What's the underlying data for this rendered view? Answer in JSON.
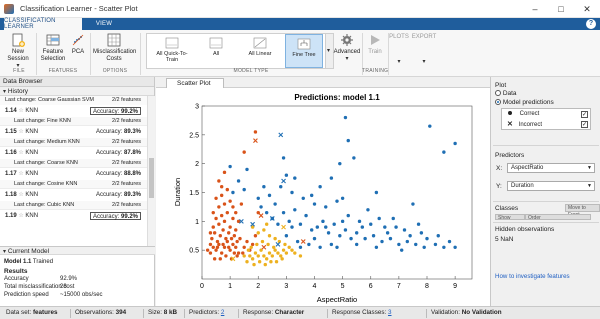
{
  "window": {
    "title": "Classification Learner - Scatter Plot"
  },
  "tabs": {
    "classification_learner": "CLASSIFICATION LEARNER",
    "view": "VIEW",
    "help": "?"
  },
  "toolstrip": {
    "new_session": "New Session",
    "feature_selection": "Feature Selection",
    "pca": "PCA",
    "misclassification_costs": "Misclassification Costs",
    "gallery": [
      {
        "label": "All Quick-To-Train"
      },
      {
        "label": "All"
      },
      {
        "label": "All Linear"
      },
      {
        "label": "Fine Tree"
      }
    ],
    "advanced": "Advanced",
    "train": "Train",
    "plots": "PLOTS",
    "export": "EXPORT",
    "sections": {
      "file": "FILE",
      "features": "FEATURES",
      "options": "OPTIONS",
      "model_type": "MODEL TYPE",
      "training": "TRAINING"
    }
  },
  "left": {
    "data_browser": "Data Browser",
    "history_title": "History",
    "top_last_change": "Coarse Gaussian SVM",
    "top_features": "2/2 features",
    "models": [
      {
        "id": "1.14",
        "name": "KNN",
        "accuracy": "99.2%",
        "acc_label": "Accuracy:",
        "last_change": "Fine KNN",
        "features": "2/2 features",
        "boxed": true
      },
      {
        "id": "1.15",
        "name": "KNN",
        "accuracy": "89.3%",
        "acc_label": "Accuracy:",
        "last_change": "Medium KNN",
        "features": "2/2 features",
        "boxed": false
      },
      {
        "id": "1.16",
        "name": "KNN",
        "accuracy": "87.8%",
        "acc_label": "Accuracy:",
        "last_change": "Coarse KNN",
        "features": "2/2 features",
        "boxed": false
      },
      {
        "id": "1.17",
        "name": "KNN",
        "accuracy": "88.8%",
        "acc_label": "Accuracy:",
        "last_change": "Cosine KNN",
        "features": "2/2 features",
        "boxed": false
      },
      {
        "id": "1.18",
        "name": "KNN",
        "accuracy": "89.3%",
        "acc_label": "Accuracy:",
        "last_change": "Cubic KNN",
        "features": "2/2 features",
        "boxed": false
      },
      {
        "id": "1.19",
        "name": "KNN",
        "accuracy": "99.2%",
        "acc_label": "Accuracy:",
        "last_change": "",
        "features": "",
        "boxed": true
      }
    ],
    "last_change_label": "Last change:",
    "current_model_title": "Current Model",
    "current_model": {
      "name": "Model 1.1",
      "status": "Trained"
    },
    "results_title": "Results",
    "results": [
      {
        "label": "Accuracy",
        "value": "92.9%"
      },
      {
        "label": "Total misclassification cost",
        "value": "28"
      },
      {
        "label": "Prediction speed",
        "value": "~15000 obs/sec"
      }
    ]
  },
  "center": {
    "tab_label": "Scatter Plot",
    "plot_title": "Predictions: model 1.1"
  },
  "chart_data": {
    "type": "scatter",
    "title": "Predictions: model 1.1",
    "xlabel": "AspectRatio",
    "ylabel": "Duration",
    "xlim": [
      0,
      9.6
    ],
    "ylim": [
      0,
      3.0
    ],
    "xticks": [
      0,
      1,
      2,
      3,
      4,
      5,
      6,
      7,
      8,
      9
    ],
    "yticks": [
      0.5,
      1,
      1.5,
      2,
      2.5,
      3
    ],
    "grid": false,
    "series": [
      {
        "name": "",
        "color": "#1f6fb4",
        "marker": "dot",
        "points": [
          [
            2.9,
            1.15
          ],
          [
            3.1,
            1.0
          ],
          [
            3.3,
            1.2
          ],
          [
            3.5,
            0.95
          ],
          [
            3.7,
            1.1
          ],
          [
            3.9,
            0.85
          ],
          [
            4.1,
            0.9
          ],
          [
            4.3,
            1.0
          ],
          [
            4.5,
            0.8
          ],
          [
            4.7,
            0.95
          ],
          [
            4.9,
            0.75
          ],
          [
            5.1,
            0.85
          ],
          [
            5.3,
            0.7
          ],
          [
            5.5,
            0.8
          ],
          [
            5.8,
            0.7
          ],
          [
            6.1,
            0.75
          ],
          [
            6.4,
            0.65
          ],
          [
            6.7,
            0.7
          ],
          [
            7.0,
            0.6
          ],
          [
            7.3,
            0.65
          ],
          [
            7.6,
            0.6
          ],
          [
            7.9,
            0.55
          ],
          [
            8.3,
            0.6
          ],
          [
            8.6,
            0.55
          ],
          [
            9.0,
            0.55
          ],
          [
            3.2,
            1.5
          ],
          [
            3.6,
            1.4
          ],
          [
            4.0,
            1.3
          ],
          [
            4.4,
            1.25
          ],
          [
            4.8,
            1.35
          ],
          [
            5.2,
            1.1
          ],
          [
            5.6,
            1.0
          ],
          [
            6.0,
            0.95
          ],
          [
            6.5,
            0.9
          ],
          [
            7.2,
            0.85
          ],
          [
            7.8,
            0.8
          ],
          [
            8.4,
            0.75
          ],
          [
            2.6,
            1.3
          ],
          [
            2.8,
            1.6
          ],
          [
            3.0,
            1.8
          ],
          [
            2.9,
            2.1
          ],
          [
            3.3,
            1.75
          ],
          [
            4.2,
            1.6
          ],
          [
            5.0,
            1.4
          ],
          [
            5.9,
            1.2
          ],
          [
            6.8,
            1.05
          ],
          [
            4.6,
            1.75
          ],
          [
            6.2,
            1.5
          ],
          [
            7.5,
            1.3
          ],
          [
            5.4,
            2.1
          ],
          [
            5.2,
            2.4
          ],
          [
            4.9,
            2.0
          ],
          [
            5.1,
            2.8
          ],
          [
            8.1,
            2.65
          ],
          [
            8.6,
            2.2
          ],
          [
            9.0,
            2.35
          ],
          [
            1.0,
            1.95
          ],
          [
            1.3,
            1.7
          ],
          [
            1.1,
            1.5
          ],
          [
            1.6,
            1.9
          ],
          [
            1.5,
            1.55
          ],
          [
            2.0,
            1.4
          ],
          [
            2.2,
            1.6
          ],
          [
            2.3,
            1.15
          ],
          [
            2.5,
            1.05
          ],
          [
            2.7,
            0.95
          ],
          [
            3.4,
            0.65
          ],
          [
            3.8,
            0.6
          ],
          [
            4.2,
            0.55
          ],
          [
            4.8,
            0.55
          ],
          [
            5.5,
            0.6
          ],
          [
            6.2,
            0.55
          ],
          [
            7.1,
            0.5
          ],
          [
            6.9,
            0.9
          ],
          [
            7.7,
            0.95
          ],
          [
            3.0,
            0.75
          ],
          [
            3.5,
            0.55
          ],
          [
            4.0,
            0.7
          ],
          [
            4.6,
            0.6
          ],
          [
            5.0,
            1.0
          ],
          [
            5.7,
            0.9
          ],
          [
            6.3,
            1.05
          ],
          [
            3.9,
            1.45
          ],
          [
            4.4,
            0.9
          ],
          [
            2.1,
            1.25
          ],
          [
            2.4,
            1.45
          ],
          [
            3.2,
            0.9
          ],
          [
            6.6,
            0.8
          ],
          [
            7.4,
            0.75
          ],
          [
            8.0,
            0.7
          ],
          [
            8.8,
            0.65
          ]
        ]
      },
      {
        "name": "",
        "color": "#d95319",
        "marker": "dot",
        "points": [
          [
            0.3,
            0.45
          ],
          [
            0.4,
            0.55
          ],
          [
            0.5,
            0.5
          ],
          [
            0.6,
            0.6
          ],
          [
            0.7,
            0.45
          ],
          [
            0.8,
            0.55
          ],
          [
            0.9,
            0.65
          ],
          [
            1.0,
            0.5
          ],
          [
            1.1,
            0.6
          ],
          [
            1.2,
            0.55
          ],
          [
            1.3,
            0.45
          ],
          [
            0.35,
            0.7
          ],
          [
            0.45,
            0.8
          ],
          [
            0.55,
            0.65
          ],
          [
            0.65,
            0.75
          ],
          [
            0.75,
            0.85
          ],
          [
            0.85,
            0.7
          ],
          [
            0.95,
            0.8
          ],
          [
            1.05,
            0.7
          ],
          [
            1.15,
            0.75
          ],
          [
            1.25,
            0.65
          ],
          [
            1.35,
            0.7
          ],
          [
            0.4,
            0.9
          ],
          [
            0.6,
            0.95
          ],
          [
            0.8,
            1.0
          ],
          [
            1.0,
            0.9
          ],
          [
            1.2,
            0.85
          ],
          [
            0.5,
            1.05
          ],
          [
            0.7,
            1.1
          ],
          [
            0.9,
            1.15
          ],
          [
            1.1,
            1.05
          ],
          [
            0.6,
            1.25
          ],
          [
            0.8,
            1.3
          ],
          [
            0.7,
            1.45
          ],
          [
            0.9,
            1.55
          ],
          [
            0.5,
            1.4
          ],
          [
            0.6,
            1.7
          ],
          [
            0.8,
            1.85
          ],
          [
            0.7,
            1.6
          ],
          [
            1.0,
            1.35
          ],
          [
            1.3,
            1.0
          ],
          [
            1.5,
            0.55
          ],
          [
            1.6,
            0.65
          ],
          [
            1.7,
            0.5
          ],
          [
            0.3,
            0.6
          ],
          [
            0.2,
            0.5
          ],
          [
            0.3,
            0.8
          ],
          [
            0.45,
            0.35
          ],
          [
            0.65,
            0.35
          ],
          [
            0.85,
            0.4
          ],
          [
            1.05,
            0.35
          ],
          [
            1.25,
            0.4
          ],
          [
            1.45,
            0.45
          ],
          [
            0.55,
            0.55
          ],
          [
            0.75,
            0.6
          ],
          [
            0.95,
            0.55
          ],
          [
            1.15,
            0.45
          ],
          [
            0.4,
            1.15
          ],
          [
            1.1,
            1.25
          ],
          [
            1.2,
            1.15
          ],
          [
            1.8,
            0.6
          ],
          [
            1.9,
            0.75
          ],
          [
            2.0,
            1.15
          ],
          [
            1.9,
            2.55
          ],
          [
            1.5,
            2.2
          ],
          [
            1.4,
            1.3
          ]
        ]
      },
      {
        "name": "",
        "color": "#edb120",
        "marker": "dot",
        "points": [
          [
            1.7,
            0.4
          ],
          [
            1.8,
            0.35
          ],
          [
            1.9,
            0.45
          ],
          [
            2.0,
            0.4
          ],
          [
            2.1,
            0.5
          ],
          [
            2.2,
            0.4
          ],
          [
            2.3,
            0.35
          ],
          [
            2.4,
            0.45
          ],
          [
            2.5,
            0.4
          ],
          [
            2.6,
            0.5
          ],
          [
            2.7,
            0.45
          ],
          [
            2.8,
            0.4
          ],
          [
            2.9,
            0.5
          ],
          [
            3.0,
            0.45
          ],
          [
            3.1,
            0.55
          ],
          [
            3.2,
            0.5
          ],
          [
            1.6,
            0.3
          ],
          [
            1.75,
            0.55
          ],
          [
            1.95,
            0.6
          ],
          [
            2.15,
            0.65
          ],
          [
            2.35,
            0.6
          ],
          [
            2.55,
            0.55
          ],
          [
            2.75,
            0.65
          ],
          [
            2.95,
            0.6
          ],
          [
            3.3,
            0.45
          ],
          [
            3.5,
            0.4
          ],
          [
            1.5,
            0.4
          ],
          [
            1.65,
            0.5
          ],
          [
            1.85,
            0.25
          ],
          [
            2.05,
            0.3
          ],
          [
            2.25,
            0.25
          ],
          [
            2.45,
            0.3
          ],
          [
            2.65,
            0.3
          ],
          [
            2.85,
            0.35
          ],
          [
            2.0,
            0.8
          ],
          [
            2.2,
            0.85
          ],
          [
            2.4,
            0.75
          ],
          [
            1.8,
            0.9
          ],
          [
            2.6,
            0.7
          ],
          [
            2.3,
            0.95
          ]
        ]
      }
    ],
    "incorrect": [
      {
        "x": 1.9,
        "y": 2.4,
        "color": "#d95319"
      },
      {
        "x": 2.8,
        "y": 2.5,
        "color": "#1f6fb4"
      },
      {
        "x": 2.9,
        "y": 1.7,
        "color": "#1f6fb4"
      },
      {
        "x": 2.1,
        "y": 1.1,
        "color": "#d95319"
      },
      {
        "x": 2.5,
        "y": 1.05,
        "color": "#1f6fb4"
      },
      {
        "x": 1.4,
        "y": 1.0,
        "color": "#1f6fb4"
      },
      {
        "x": 2.9,
        "y": 0.9,
        "color": "#edb120"
      },
      {
        "x": 1.8,
        "y": 0.95,
        "color": "#1f6fb4"
      },
      {
        "x": 1.1,
        "y": 0.35,
        "color": "#edb120"
      },
      {
        "x": 2.2,
        "y": 0.55,
        "color": "#d95319"
      },
      {
        "x": 3.6,
        "y": 0.65,
        "color": "#d95319"
      },
      {
        "x": 2.7,
        "y": 0.6,
        "color": "#1f6fb4"
      }
    ]
  },
  "right": {
    "plot_section": "Plot",
    "data_radio": "Data",
    "model_predictions_radio": "Model predictions",
    "correct": "Correct",
    "incorrect": "Incorrect",
    "predictors_section": "Predictors",
    "x_label": "X:",
    "y_label": "Y:",
    "x_value": "AspectRatio",
    "y_value": "Duration",
    "classes_section": "Classes",
    "classes_btn1": "Show",
    "classes_btn2": "Order",
    "move_to_front": "Move to Front",
    "hidden_title": "Hidden observations",
    "hidden_value": "5 NaN",
    "investigate_link": "How to investigate features"
  },
  "status": {
    "data_set_label": "Data set:",
    "data_set": "features",
    "observations_label": "Observations:",
    "observations": "394",
    "size_label": "Size:",
    "size": "8 kB",
    "predictors_label": "Predictors:",
    "predictors": "2",
    "response_label": "Response:",
    "response": "Character",
    "response_classes_label": "Response Classes:",
    "response_classes": "3",
    "validation_label": "Validation:",
    "validation": "No Validation"
  },
  "colors": {
    "accent": "#1f5d9c",
    "class_blue": "#1f6fb4",
    "class_orange": "#d95319",
    "class_yellow": "#edb120",
    "link": "#1f5fc2"
  }
}
